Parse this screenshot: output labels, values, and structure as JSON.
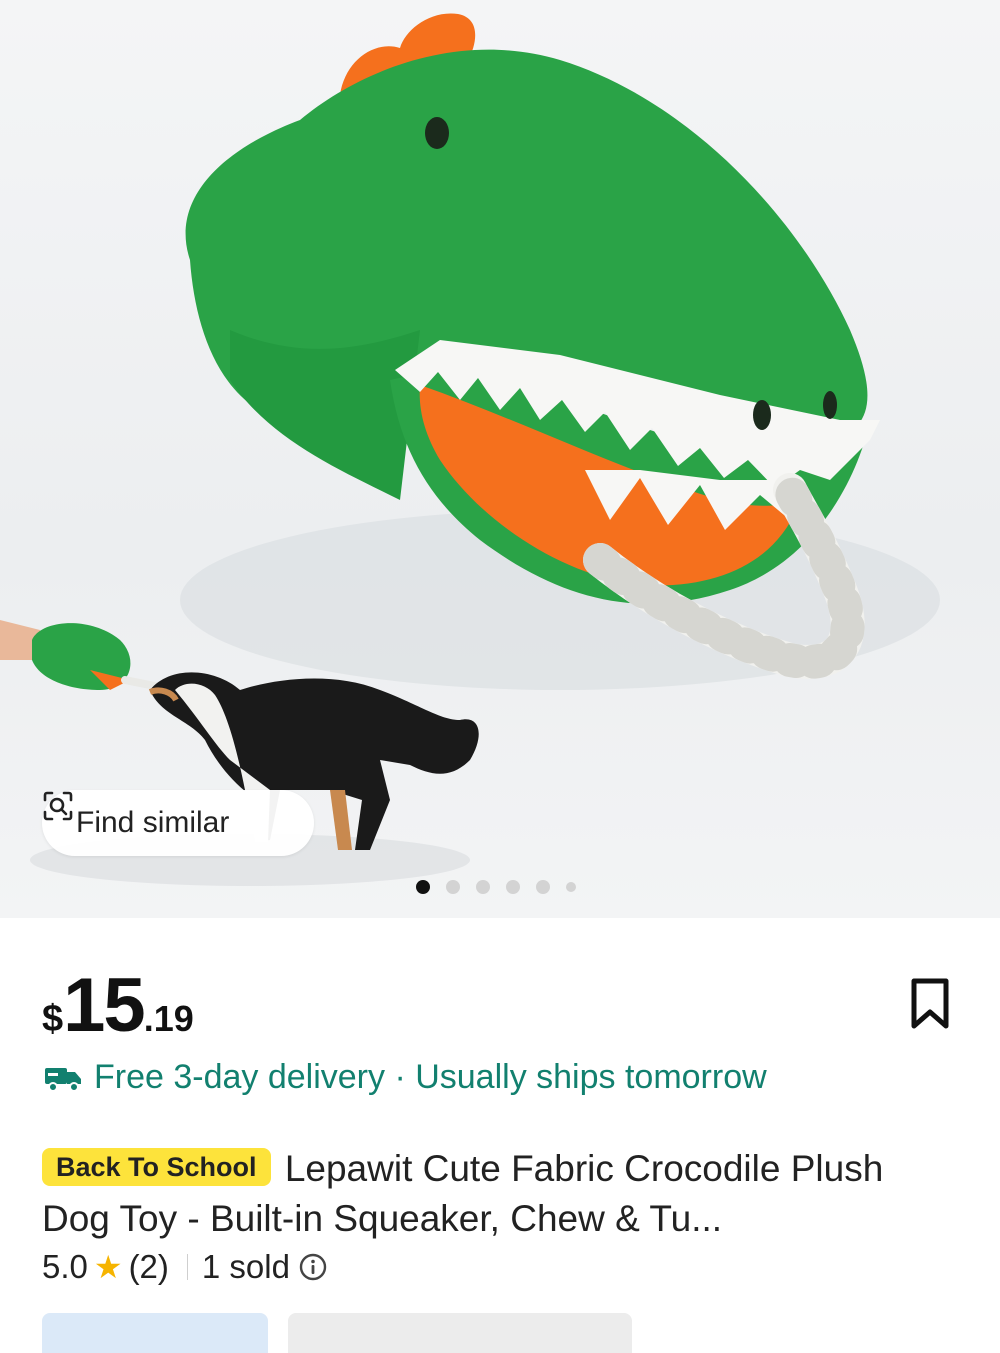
{
  "gallery": {
    "find_similar_label": "Find similar",
    "image_count": 6,
    "active_index": 0
  },
  "price": {
    "currency": "$",
    "whole": "15",
    "cents": ".19"
  },
  "delivery": {
    "text": "Free 3-day delivery · Usually ships tomorrow"
  },
  "product": {
    "badge": "Back To School",
    "title": "Lepawit Cute Fabric Crocodile Plush Dog Toy - Built-in Squeaker, Chew & Tu..."
  },
  "rating": {
    "score": "5.0",
    "count": "(2)",
    "sold": "1 sold"
  },
  "colors": {
    "accent_green": "#12806f",
    "badge_yellow": "#fde33b",
    "star": "#f6b400",
    "plush_green": "#2aa347",
    "plush_orange": "#f5701d"
  }
}
